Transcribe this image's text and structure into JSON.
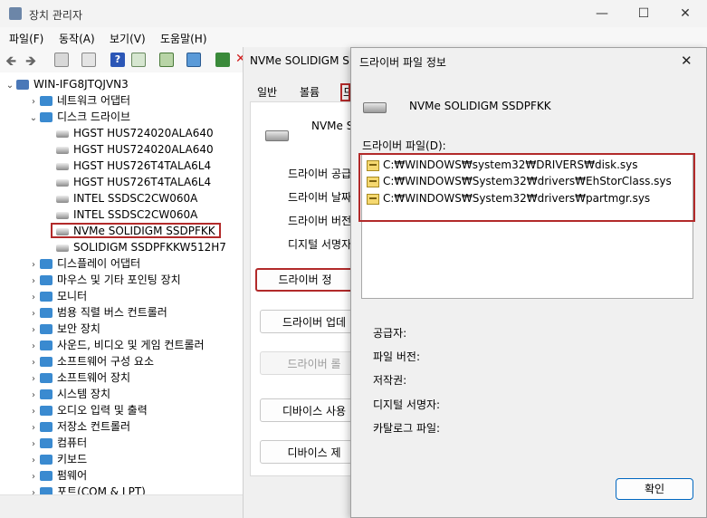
{
  "main": {
    "title": "장치 관리자",
    "menu": [
      "파일(F)",
      "동작(A)",
      "보기(V)",
      "도움말(H)"
    ],
    "tree": [
      {
        "label": "WIN-IFG8JTQJVN3",
        "level": 0,
        "expander": "v"
      },
      {
        "label": "네트워크 어댑터",
        "level": 1,
        "expander": ">"
      },
      {
        "label": "디스크 드라이브",
        "level": 1,
        "expander": "v"
      },
      {
        "label": "HGST HUS724020ALA640",
        "level": 2,
        "expander": ""
      },
      {
        "label": "HGST HUS724020ALA640",
        "level": 2,
        "expander": ""
      },
      {
        "label": "HGST HUS726T4TALA6L4",
        "level": 2,
        "expander": ""
      },
      {
        "label": "HGST HUS726T4TALA6L4",
        "level": 2,
        "expander": ""
      },
      {
        "label": "INTEL SSDSC2CW060A",
        "level": 2,
        "expander": ""
      },
      {
        "label": "INTEL SSDSC2CW060A",
        "level": 2,
        "expander": ""
      },
      {
        "label": "NVMe SOLIDIGM SSDPFKK",
        "level": 2,
        "expander": ""
      },
      {
        "label": "SOLIDIGM SSDPFKKW512H7",
        "level": 2,
        "expander": ""
      },
      {
        "label": "디스플레이 어댑터",
        "level": 1,
        "expander": ">"
      },
      {
        "label": "마우스 및 기타 포인팅 장치",
        "level": 1,
        "expander": ">"
      },
      {
        "label": "모니터",
        "level": 1,
        "expander": ">"
      },
      {
        "label": "범용 직렬 버스 컨트롤러",
        "level": 1,
        "expander": ">"
      },
      {
        "label": "보안 장치",
        "level": 1,
        "expander": ">"
      },
      {
        "label": "사운드, 비디오 및 게임 컨트롤러",
        "level": 1,
        "expander": ">"
      },
      {
        "label": "소프트웨어 구성 요소",
        "level": 1,
        "expander": ">"
      },
      {
        "label": "소프트웨어 장치",
        "level": 1,
        "expander": ">"
      },
      {
        "label": "시스템 장치",
        "level": 1,
        "expander": ">"
      },
      {
        "label": "오디오 입력 및 출력",
        "level": 1,
        "expander": ">"
      },
      {
        "label": "저장소 컨트롤러",
        "level": 1,
        "expander": ">"
      },
      {
        "label": "컴퓨터",
        "level": 1,
        "expander": ">"
      },
      {
        "label": "키보드",
        "level": 1,
        "expander": ">"
      },
      {
        "label": "펌웨어",
        "level": 1,
        "expander": ">"
      },
      {
        "label": "포트(COM & LPT)",
        "level": 1,
        "expander": ">"
      }
    ],
    "selected_index": 9
  },
  "props": {
    "title": "NVMe SOLIDIGM SSD",
    "tabs": [
      "일반",
      "볼륨",
      "드"
    ],
    "device_name": "NVMe S",
    "labels": [
      "드라이버 공급",
      "드라이버 날짜",
      "드라이버 버전",
      "디지털 서명자"
    ],
    "buttons": [
      "드라이버 정",
      "드라이버 업데",
      "드라이버 롤",
      "디바이스 사용",
      "디바이스 제"
    ]
  },
  "dialog": {
    "title": "드라이버 파일 정보",
    "device_name": "NVMe SOLIDIGM SSDPFKK",
    "files_label": "드라이버 파일(D):",
    "files": [
      "C:₩WINDOWS₩system32₩DRIVERS₩disk.sys",
      "C:₩WINDOWS₩System32₩drivers₩EhStorClass.sys",
      "C:₩WINDOWS₩System32₩drivers₩partmgr.sys"
    ],
    "info_labels": [
      "공급자:",
      "파일 버전:",
      "저작권:",
      "디지털 서명자:",
      "카탈로그 파일:"
    ],
    "ok_label": "확인"
  },
  "colors": {
    "highlight_outline": "#b22a2a",
    "ok_border": "#0067c0"
  }
}
